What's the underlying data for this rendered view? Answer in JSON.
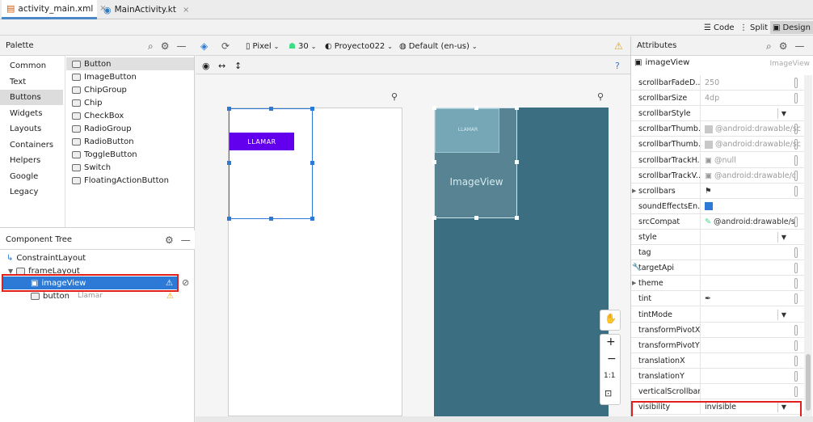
{
  "tabs": [
    {
      "label": "activity_main.xml",
      "close": "×"
    },
    {
      "label": "MainActivity.kt",
      "close": "×"
    }
  ],
  "modes": {
    "code": "Code",
    "split": "Split",
    "design": "Design"
  },
  "palette": {
    "title": "Palette",
    "categories": [
      "Common",
      "Text",
      "Buttons",
      "Widgets",
      "Layouts",
      "Containers",
      "Helpers",
      "Google",
      "Legacy"
    ],
    "widgets": [
      "Button",
      "ImageButton",
      "ChipGroup",
      "Chip",
      "CheckBox",
      "RadioGroup",
      "RadioButton",
      "ToggleButton",
      "Switch",
      "FloatingActionButton"
    ]
  },
  "toolbar": {
    "device": "Pixel",
    "api": "30",
    "theme": "Proyecto022",
    "locale": "Default (en-us)"
  },
  "component_tree": {
    "title": "Component Tree",
    "nodes": [
      {
        "label": "ConstraintLayout",
        "sub": ""
      },
      {
        "label": "frameLayout",
        "sub": ""
      },
      {
        "label": "imageView",
        "sub": ""
      },
      {
        "label": "button",
        "sub": "Llamar"
      }
    ]
  },
  "canvas": {
    "button_label": "LLAMAR",
    "blueprint_button_label": "LLAMAR",
    "imageview_label": "ImageView"
  },
  "attributes": {
    "title": "Attributes",
    "selected": "imageView",
    "selected_type": "ImageView",
    "rows": [
      {
        "name": "scrollbarFadeD...",
        "value": "250"
      },
      {
        "name": "scrollbarSize",
        "value": "4dp"
      },
      {
        "name": "scrollbarStyle",
        "value": ""
      },
      {
        "name": "scrollbarThumb...",
        "value": "@android:drawable/sc"
      },
      {
        "name": "scrollbarThumb...",
        "value": "@android:drawable/sc"
      },
      {
        "name": "scrollbarTrackH...",
        "value": "@null"
      },
      {
        "name": "scrollbarTrackV...",
        "value": "@android:drawable/c"
      },
      {
        "name": "scrollbars",
        "value": ""
      },
      {
        "name": "soundEffectsEn...",
        "value": ""
      },
      {
        "name": "srcCompat",
        "value": "@android:drawable/s"
      },
      {
        "name": "style",
        "value": ""
      },
      {
        "name": "tag",
        "value": ""
      },
      {
        "name": "targetApi",
        "value": ""
      },
      {
        "name": "theme",
        "value": ""
      },
      {
        "name": "tint",
        "value": ""
      },
      {
        "name": "tintMode",
        "value": ""
      },
      {
        "name": "transformPivotX",
        "value": ""
      },
      {
        "name": "transformPivotY",
        "value": ""
      },
      {
        "name": "translationX",
        "value": ""
      },
      {
        "name": "translationY",
        "value": ""
      },
      {
        "name": "verticalScrollbar...",
        "value": ""
      },
      {
        "name": "visibility",
        "value": "invisible"
      }
    ]
  },
  "zoom": {
    "ratio": "1:1"
  },
  "colors": {
    "accent": "#6200ee",
    "selection": "#2d7ad6",
    "highlight": "#e0201d",
    "blueprint": "#3a6e80"
  }
}
